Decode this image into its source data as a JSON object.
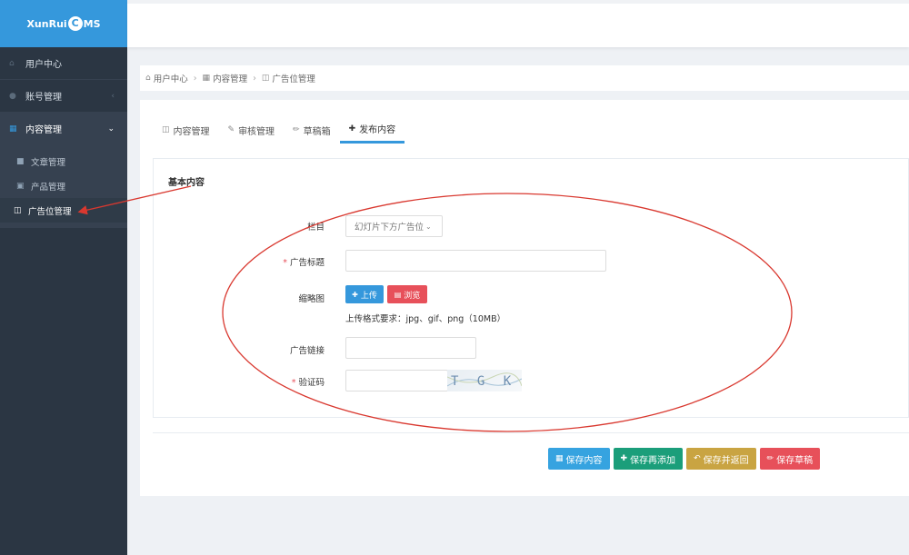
{
  "sidebar": {
    "logo": {
      "part1": "XunRui",
      "mark": "C",
      "part2": "MS"
    },
    "items": [
      {
        "label": "用户中心",
        "icon": "home-icon"
      },
      {
        "label": "账号管理",
        "icon": "user-icon"
      },
      {
        "label": "内容管理",
        "icon": "grid-icon"
      }
    ],
    "sub_items": [
      {
        "label": "文章管理",
        "icon": "article-icon"
      },
      {
        "label": "产品管理",
        "icon": "file-icon"
      },
      {
        "label": "广告位管理",
        "icon": "image-icon"
      }
    ]
  },
  "breadcrumb": {
    "items": [
      "用户中心",
      "内容管理",
      "广告位管理"
    ],
    "separator": "›"
  },
  "tabs": [
    {
      "label": "内容管理",
      "icon": "image-icon"
    },
    {
      "label": "审核管理",
      "icon": "edit-icon"
    },
    {
      "label": "草稿箱",
      "icon": "pencil-icon"
    },
    {
      "label": "发布内容",
      "icon": "plus-icon"
    }
  ],
  "form": {
    "section_title": "基本内容",
    "category": {
      "label": "栏目",
      "value": "幻灯片下方广告位"
    },
    "title": {
      "label": "广告标题",
      "value": ""
    },
    "thumbnail": {
      "label": "缩略图",
      "upload_label": "上传",
      "browse_label": "浏览",
      "hint": "上传格式要求：jpg、gif、png（10MB）"
    },
    "link": {
      "label": "广告链接",
      "value": ""
    },
    "captcha": {
      "label": "验证码",
      "value": "",
      "image_text": "T G K H"
    }
  },
  "actions": [
    {
      "label": "保存内容",
      "color": "#36a3e0"
    },
    {
      "label": "保存再添加",
      "color": "#1b9e7a"
    },
    {
      "label": "保存并返回",
      "color": "#c9a442"
    },
    {
      "label": "保存草稿",
      "color": "#e7505a"
    }
  ],
  "colors": {
    "sidebar_bg": "#2b3643",
    "logo_bg": "#3598dc",
    "accent": "#3598dc",
    "annotation": "#d9382f"
  }
}
